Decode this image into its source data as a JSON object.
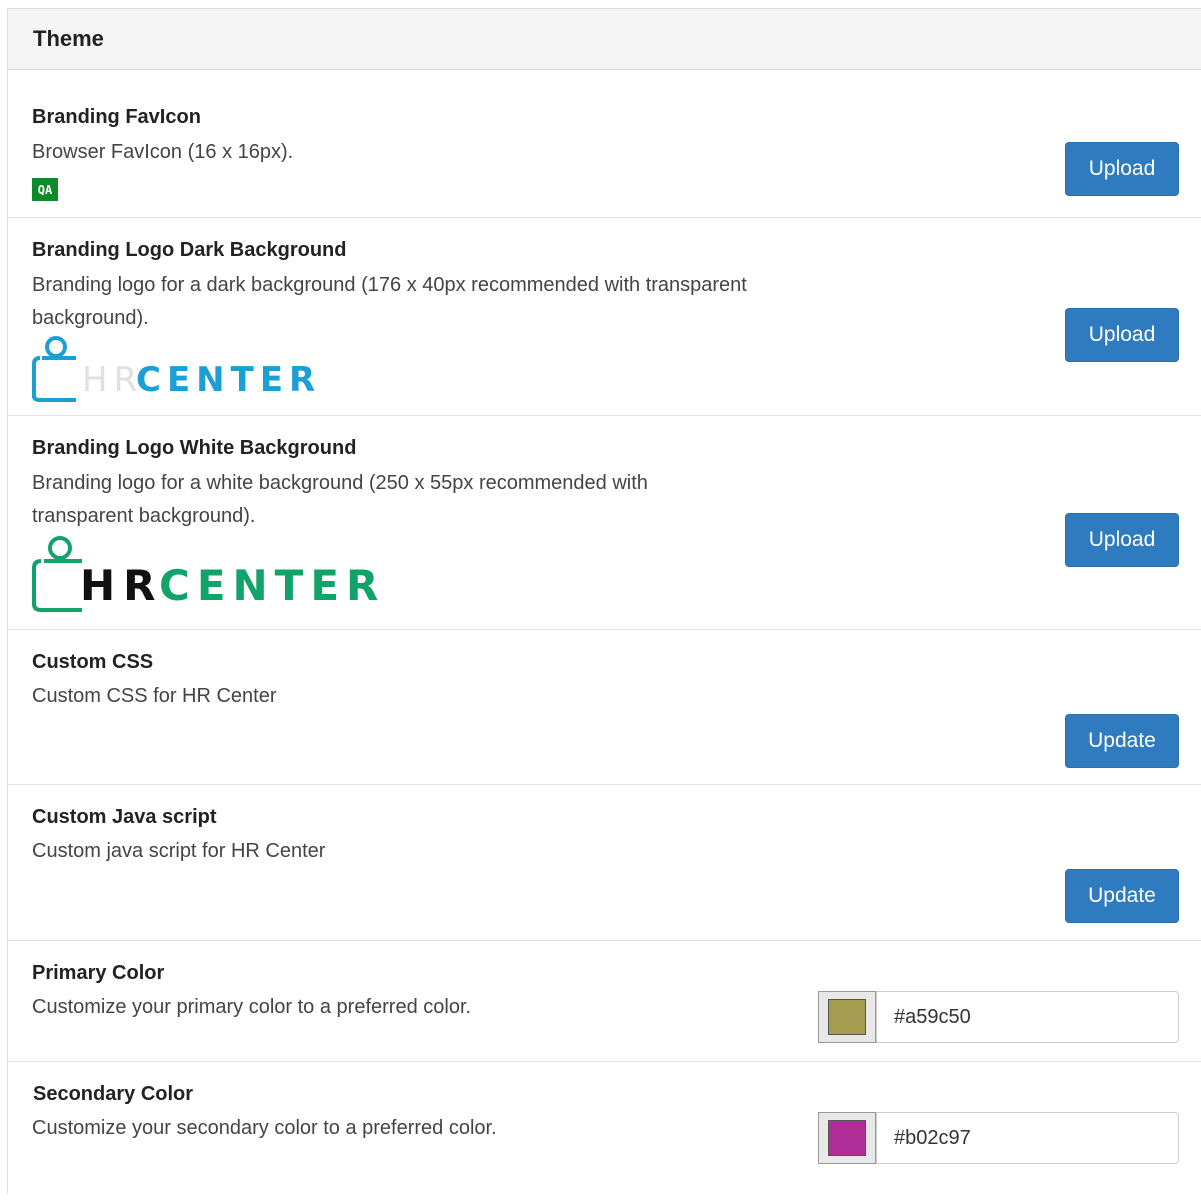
{
  "panel": {
    "title": "Theme"
  },
  "favicon": {
    "title": "Branding FavIcon",
    "description": "Browser FavIcon (16 x 16px).",
    "preview_text": "QA",
    "button_label": "Upload"
  },
  "logo_dark": {
    "title": "Branding Logo Dark Background",
    "description": "Branding logo for a dark background (176 x 40px recommended with transparent background).",
    "logo_text_hr": "HR",
    "logo_text_center": "CENTER",
    "button_label": "Upload"
  },
  "logo_white": {
    "title": "Branding Logo White Background",
    "description": "Branding logo for a white background (250 x 55px recommended with transparent background).",
    "logo_text_hr": "HR",
    "logo_text_center": "CENTER",
    "button_label": "Upload"
  },
  "custom_css": {
    "title": "Custom CSS",
    "description": "Custom CSS for HR Center",
    "button_label": "Update"
  },
  "custom_js": {
    "title": "Custom Java script",
    "description": "Custom java script for HR Center",
    "button_label": "Update"
  },
  "primary_color": {
    "title": "Primary Color",
    "description": "Customize your primary color to a preferred color.",
    "value": "#a59c50"
  },
  "secondary_color": {
    "title": "Secondary Color",
    "description": "Customize your secondary color to a preferred color.",
    "value": "#b02c97"
  },
  "colors": {
    "button": "#2e7bbf",
    "logo_dark_accent": "#1a9fd6",
    "logo_white_accent": "#12a36a",
    "favicon_bg": "#0f8a2a"
  },
  "icons": {
    "favicon_preview": "qa-favicon-icon",
    "logo_dark": "hr-center-logo-dark",
    "logo_white": "hr-center-logo-white"
  }
}
